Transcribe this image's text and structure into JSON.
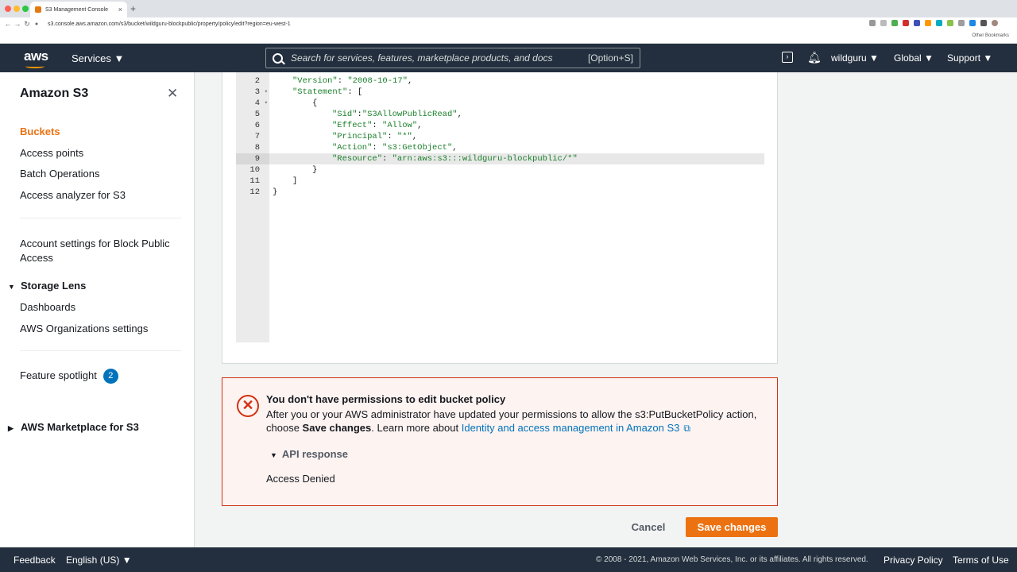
{
  "browser": {
    "tab_title": "S3 Management Console",
    "url": "s3.console.aws.amazon.com/s3/bucket/wildguru-blockpublic/property/policy/edit?region=eu-west-1",
    "other_bookmarks": "Other Bookmarks",
    "new_tab": "+",
    "close_tab": "×"
  },
  "header": {
    "logo": "aws",
    "services": "Services ▼",
    "search_placeholder": "Search for services, features, marketplace products, and docs",
    "search_shortcut": "[Option+S]",
    "account": "wildguru ▼",
    "region": "Global ▼",
    "support": "Support ▼"
  },
  "sidebar": {
    "title": "Amazon S3",
    "items": [
      {
        "label": "Buckets"
      },
      {
        "label": "Access points"
      },
      {
        "label": "Batch Operations"
      },
      {
        "label": "Access analyzer for S3"
      }
    ],
    "account_settings_line1": "Account settings for Block Public",
    "account_settings_line2": "Access",
    "storage_lens": {
      "label": "Storage Lens",
      "items": [
        "Dashboards",
        "AWS Organizations settings"
      ]
    },
    "feature_spotlight": "Feature spotlight",
    "feature_badge": "2",
    "marketplace": "AWS Marketplace for S3"
  },
  "editor": {
    "line_numbers": [
      "2",
      "3",
      "4",
      "5",
      "6",
      "7",
      "8",
      "9",
      "10",
      "11",
      "12"
    ],
    "lines": [
      {
        "key": "\"Version\"",
        "sep": ": ",
        "val": "\"2008-10-17\"",
        "tail": ","
      },
      {
        "key": "\"Statement\"",
        "sep": ": ",
        "val": "",
        "tail": "["
      },
      {
        "key": "",
        "sep": "",
        "val": "",
        "tail": "{"
      },
      {
        "key": "\"Sid\"",
        "sep": ":",
        "val": "\"S3AllowPublicRead\"",
        "tail": ","
      },
      {
        "key": "\"Effect\"",
        "sep": ": ",
        "val": "\"Allow\"",
        "tail": ","
      },
      {
        "key": "\"Principal\"",
        "sep": ": ",
        "val": "\"*\"",
        "tail": ","
      },
      {
        "key": "\"Action\"",
        "sep": ": ",
        "val": "\"s3:GetObject\"",
        "tail": ","
      },
      {
        "key": "\"Resource\"",
        "sep": ": ",
        "val": "\"arn:aws:s3:::wildguru-blockpublic/*\"",
        "tail": ""
      },
      {
        "key": "",
        "sep": "",
        "val": "",
        "tail": "}"
      },
      {
        "key": "",
        "sep": "",
        "val": "",
        "tail": "]"
      },
      {
        "key": "",
        "sep": "",
        "val": "",
        "tail": "}"
      }
    ]
  },
  "alert": {
    "title": "You don't have permissions to edit bucket policy",
    "body_line1": "After you or your AWS administrator have updated your permissions to allow the s3:PutBucketPolicy action,",
    "body_pre": "choose ",
    "body_bold": "Save changes",
    "body_mid": ". Learn more about ",
    "link": "Identity and access management in Amazon S3",
    "api_toggle": "API response",
    "api_text": "Access Denied"
  },
  "actions": {
    "cancel": "Cancel",
    "save": "Save changes"
  },
  "footer": {
    "feedback": "Feedback",
    "language": "English (US) ▼",
    "copyright": "© 2008 - 2021, Amazon Web Services, Inc. or its affiliates. All rights reserved.",
    "privacy": "Privacy Policy",
    "terms": "Terms of Use"
  },
  "colors": {
    "header_bg": "#232f3e",
    "accent_orange": "#ec7211",
    "link_blue": "#0073bb",
    "error_red": "#d13212",
    "string_green": "#1a7f2a"
  }
}
